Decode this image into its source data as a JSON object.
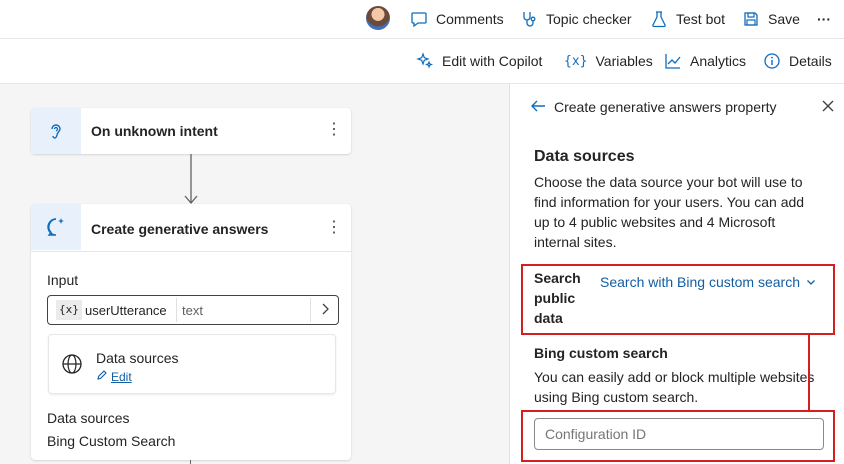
{
  "topbar": {
    "comments": "Comments",
    "topic_checker": "Topic checker",
    "test_bot": "Test bot",
    "save": "Save",
    "more": "···"
  },
  "subbar": {
    "edit_copilot": "Edit with Copilot",
    "variables": "Variables",
    "analytics": "Analytics",
    "details": "Details"
  },
  "canvas": {
    "trigger": {
      "title": "On unknown intent",
      "icon": "ear-icon"
    },
    "action": {
      "title": "Create generative answers",
      "input_label": "Input",
      "var_icon": "{x}",
      "var_name": "userUtterance",
      "var_type": "text",
      "datasources_card_title": "Data sources",
      "edit_label": "Edit",
      "datasources_label": "Data sources",
      "datasources_value": "Bing Custom Search"
    }
  },
  "panel": {
    "title": "Create generative answers property",
    "section_title": "Data sources",
    "description": "Choose the data source your bot will use to find information for your users. You can add up to 4 public websites and 4 Microsoft internal sites.",
    "search_public_label": "Search public data",
    "search_public_value": "Search with Bing custom search",
    "bing_title": "Bing custom search",
    "bing_desc": "You can easily add or block multiple websites using Bing custom search.",
    "config_placeholder": "Configuration ID"
  },
  "colors": {
    "accent": "#0f6cbd",
    "highlight": "#d21f1f",
    "link": "#115ea3"
  }
}
